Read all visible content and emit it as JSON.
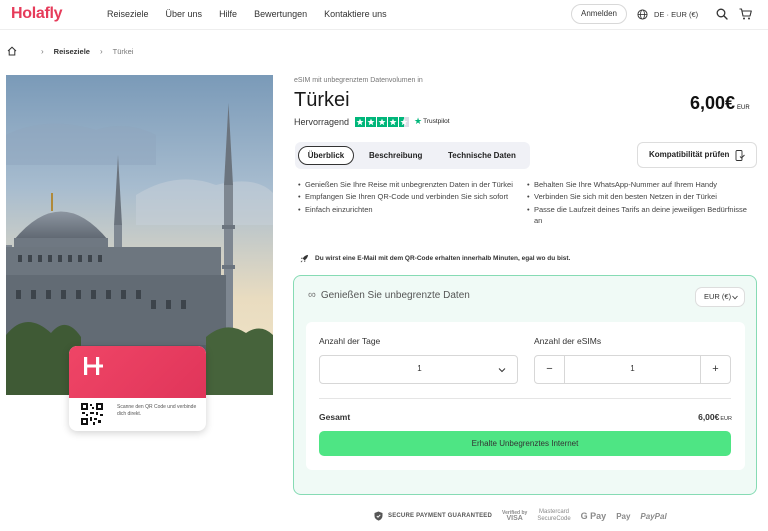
{
  "header": {
    "logo": "Holafly",
    "nav": [
      "Reiseziele",
      "Über uns",
      "Hilfe",
      "Bewertungen",
      "Kontaktiere uns"
    ],
    "login_label": "Anmelden",
    "locale": "DE · EUR (€)",
    "icons": [
      "globe-icon",
      "search-icon",
      "cart-icon"
    ]
  },
  "breadcrumb": {
    "items": [
      "Reiseziele",
      "Türkei"
    ]
  },
  "card": {
    "text": "Scanne den QR Code und verbinde dich direkt."
  },
  "product": {
    "subtitle": "eSIM mit unbegrenztem Datenvolumen in",
    "title": "Türkei",
    "price": "6,00€",
    "price_currency": "EUR",
    "rating_label": "Hervorragend",
    "rating_stars": 4.5,
    "trustpilot": "Trustpilot"
  },
  "tabs": [
    {
      "label": "Überblick",
      "active": true
    },
    {
      "label": "Beschreibung",
      "active": false
    },
    {
      "label": "Technische Daten",
      "active": false
    }
  ],
  "compat_label": "Kompatibilität prüfen",
  "features_left": [
    "Genießen Sie Ihre Reise mit unbegrenzten Daten in der Türkei",
    "Empfangen Sie Ihren QR-Code und verbinden Sie sich sofort",
    "Einfach einzurichten"
  ],
  "features_right": [
    "Behalten Sie Ihre WhatsApp-Nummer auf Ihrem Handy",
    "Verbinden Sie sich mit den besten Netzen in der Türkei",
    "Passe die Laufzeit deines Tarifs an deine jeweiligen Bedürfnisse an"
  ],
  "email_note": "Du wirst eine E-Mail mit dem QR-Code erhalten innerhalb Minuten, egal wo du bist.",
  "booking": {
    "heading_symbol": "∞",
    "heading": "Genießen Sie unbegrenzte Daten",
    "currency_select": "EUR (€)",
    "days_label": "Anzahl der Tage",
    "days_value": "1",
    "esims_label": "Anzahl der eSIMs",
    "esims_value": "1",
    "total_label": "Gesamt",
    "total_value": "6,00€",
    "total_currency": "EUR",
    "cta": "Erhalte Unbegrenztes Internet"
  },
  "payment": {
    "secure": "SECURE PAYMENT GUARANTEED",
    "verified_by": "Verified by",
    "visa": "VISA",
    "mastercard": "Mastercard",
    "securecode": "SecureCode",
    "gpay": "G Pay",
    "applepay": "Pay",
    "paypal": "PayPal"
  },
  "colors": {
    "brand": "#e63b5a",
    "cta": "#4ee584",
    "box_border": "#86dbb4",
    "trustpilot": "#00b67a"
  }
}
